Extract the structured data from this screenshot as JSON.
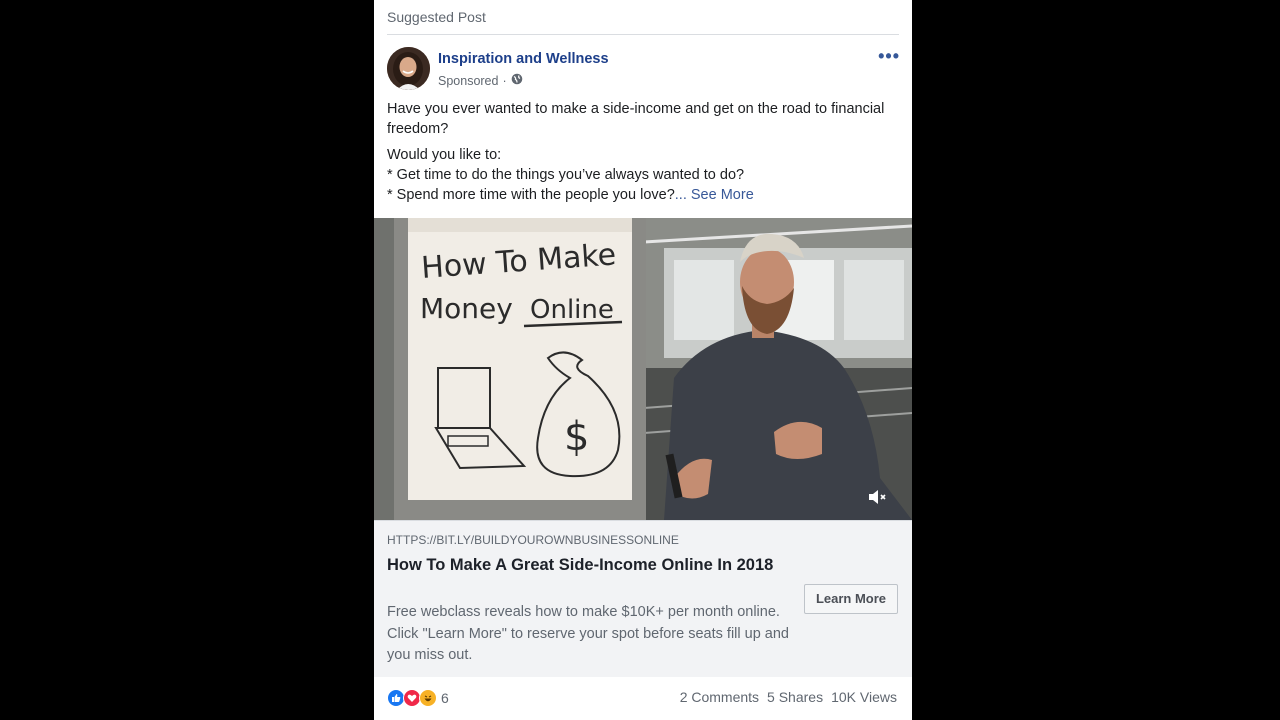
{
  "post": {
    "suggested_label": "Suggested Post",
    "page_name": "Inspiration and Wellness",
    "sponsored": "Sponsored",
    "meta_separator": "·",
    "body": {
      "para1": "Have you ever wanted to make a side-income and get on the road to financial freedom?",
      "line1": "Would you like to:",
      "line2": "* Get time to do the things you’ve always wanted to do?",
      "line3": "* Spend more time with the people you love?",
      "ellipsis": "...",
      "see_more": "See More"
    },
    "video": {
      "flipchart_title_line1": "How To Make",
      "flipchart_title_line2": "Money",
      "flipchart_title_line2b": "Online",
      "dollar": "$",
      "mute_icon": "speaker-muted-icon"
    },
    "link": {
      "url": "HTTPS://BIT.LY/BUILDYOUROWNBUSINESSONLINE",
      "headline": "How To Make A Great Side-Income Online In 2018",
      "description": "Free webclass reveals how to make $10K+ per month online. Click \"Learn More\" to reserve your spot before seats fill up and you miss out.",
      "cta": "Learn More"
    },
    "footer": {
      "reaction_count": "6",
      "comments": "2 Comments",
      "shares": "5 Shares",
      "views": "10K Views"
    },
    "colors": {
      "link_blue": "#385898",
      "name_blue": "#1d3f8a",
      "like_blue": "#1877f2",
      "love_red": "#f02849",
      "haha_yellow": "#f7b125"
    }
  }
}
